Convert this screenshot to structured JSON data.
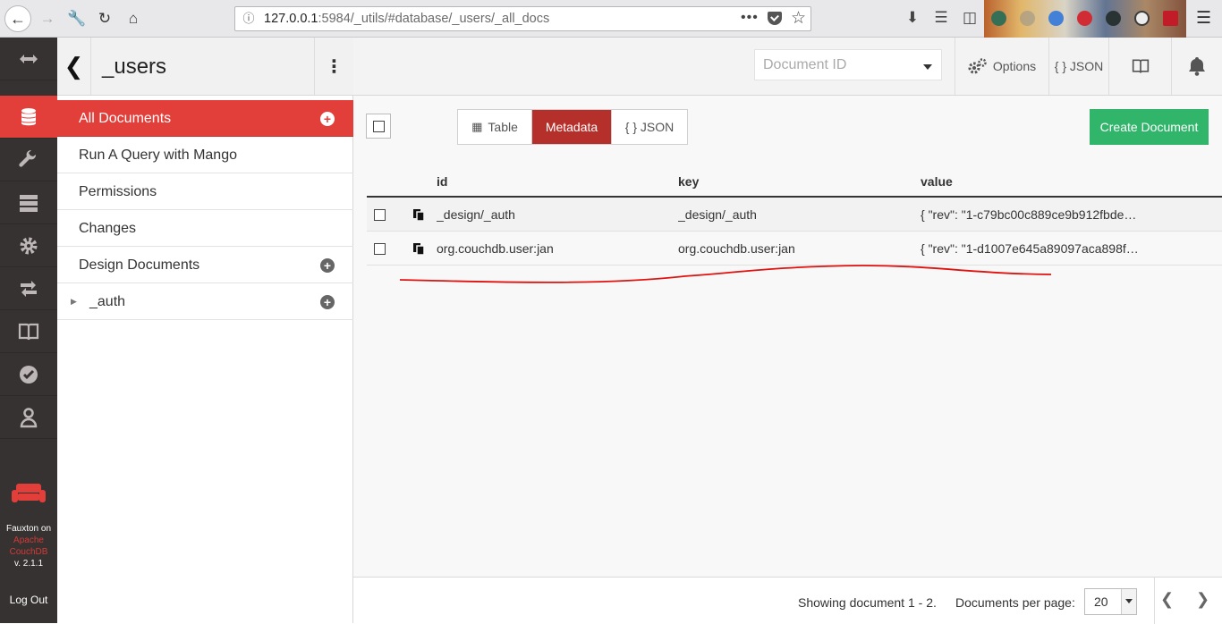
{
  "browser": {
    "url_host": "127.0.0.1",
    "url_rest": ":5984/_utils/#database/_users/_all_docs",
    "url_dots": "•••"
  },
  "rail": {
    "brand_line1": "Fauxton on",
    "brand_line2": "Apache",
    "brand_line3": "CouchDB",
    "version": "v. 2.1.1",
    "logout": "Log Out"
  },
  "sidebar": {
    "db_name": "_users",
    "items": [
      {
        "label": "All Documents"
      },
      {
        "label": "Run A Query with Mango"
      },
      {
        "label": "Permissions"
      },
      {
        "label": "Changes"
      },
      {
        "label": "Design Documents"
      },
      {
        "label": "_auth"
      }
    ]
  },
  "topbar": {
    "docid_placeholder": "Document ID",
    "options": "Options",
    "json": "{ } JSON"
  },
  "toolbar": {
    "views": [
      {
        "label": "Table"
      },
      {
        "label": "Metadata"
      },
      {
        "label": "{ } JSON"
      }
    ],
    "create_document": "Create Document"
  },
  "table": {
    "headers": [
      "id",
      "key",
      "value"
    ],
    "rows": [
      {
        "id": "_design/_auth",
        "key": "_design/_auth",
        "value": "{ \"rev\": \"1-c79bc00c889ce9b912fbde…"
      },
      {
        "id": "org.couchdb.user:jan",
        "key": "org.couchdb.user:jan",
        "value": "{ \"rev\": \"1-d1007e645a89097aca898f…"
      }
    ]
  },
  "footer": {
    "showing": "Showing document 1 - 2.",
    "per_page_label": "Documents per page:",
    "per_page_value": "20"
  },
  "colors": {
    "accent_red": "#e33f3a",
    "active_view": "#b6302b",
    "create_green": "#31b56a",
    "rail_bg": "#373232"
  },
  "icons": [
    "back-arrow-icon",
    "forward-arrow-icon",
    "wrench-icon",
    "reload-icon",
    "home-icon",
    "info-icon",
    "pocket-icon",
    "star-icon",
    "download-icon",
    "library-icon",
    "sidebar-icon",
    "menu-icon",
    "arrows-icon",
    "database-icon",
    "wrench-icon",
    "server-icon",
    "gear-icon",
    "replication-icon",
    "book-icon",
    "check-icon",
    "user-icon",
    "couch-logo-icon",
    "chevron-left-icon",
    "kebab-icon",
    "plus-circle-icon",
    "caret-right-icon",
    "table-icon",
    "copy-icon",
    "bell-icon",
    "chevron-right-icon"
  ]
}
